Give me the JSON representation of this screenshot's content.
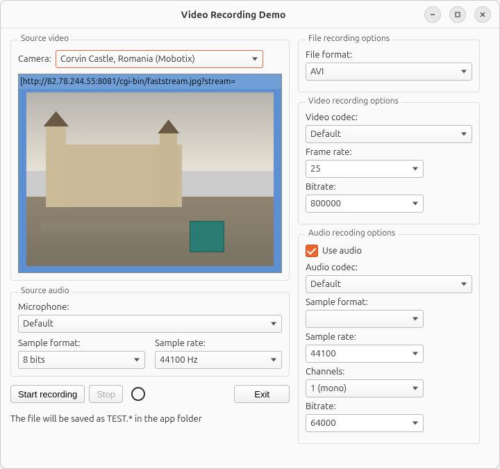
{
  "window": {
    "title": "Video Recording Demo"
  },
  "source_video": {
    "group_title": "Source video",
    "camera_label": "Camera:",
    "camera_value": "Corvin Castle, Romania (Mobotix)",
    "preview_url": "[http://82.78.244.55:8081/cgi-bin/faststream.jpg?stream="
  },
  "source_audio": {
    "group_title": "Source audio",
    "microphone_label": "Microphone:",
    "microphone_value": "Default",
    "sample_format_label": "Sample format:",
    "sample_format_value": "8 bits",
    "sample_rate_label": "Sample rate:",
    "sample_rate_value": "44100 Hz"
  },
  "file_recording": {
    "group_title": "File recording options",
    "file_format_label": "File format:",
    "file_format_value": "AVI"
  },
  "video_recording": {
    "group_title": "Video recording options",
    "video_codec_label": "Video codec:",
    "video_codec_value": "Default",
    "frame_rate_label": "Frame rate:",
    "frame_rate_value": "25",
    "bitrate_label": "Bitrate:",
    "bitrate_value": "800000"
  },
  "audio_recording": {
    "group_title": "Audio recoding options",
    "use_audio_label": "Use audio",
    "use_audio_checked": true,
    "audio_codec_label": "Audio codec:",
    "audio_codec_value": "Default",
    "sample_format_label": "Sample format:",
    "sample_format_value": "",
    "sample_rate_label": "Sample rate:",
    "sample_rate_value": "44100",
    "channels_label": "Channels:",
    "channels_value": "1 (mono)",
    "bitrate_label": "Bitrate:",
    "bitrate_value": "64000"
  },
  "actions": {
    "start_label": "Start recording",
    "stop_label": "Stop",
    "exit_label": "Exit"
  },
  "note": "The file will be saved as TEST.* in the app folder"
}
